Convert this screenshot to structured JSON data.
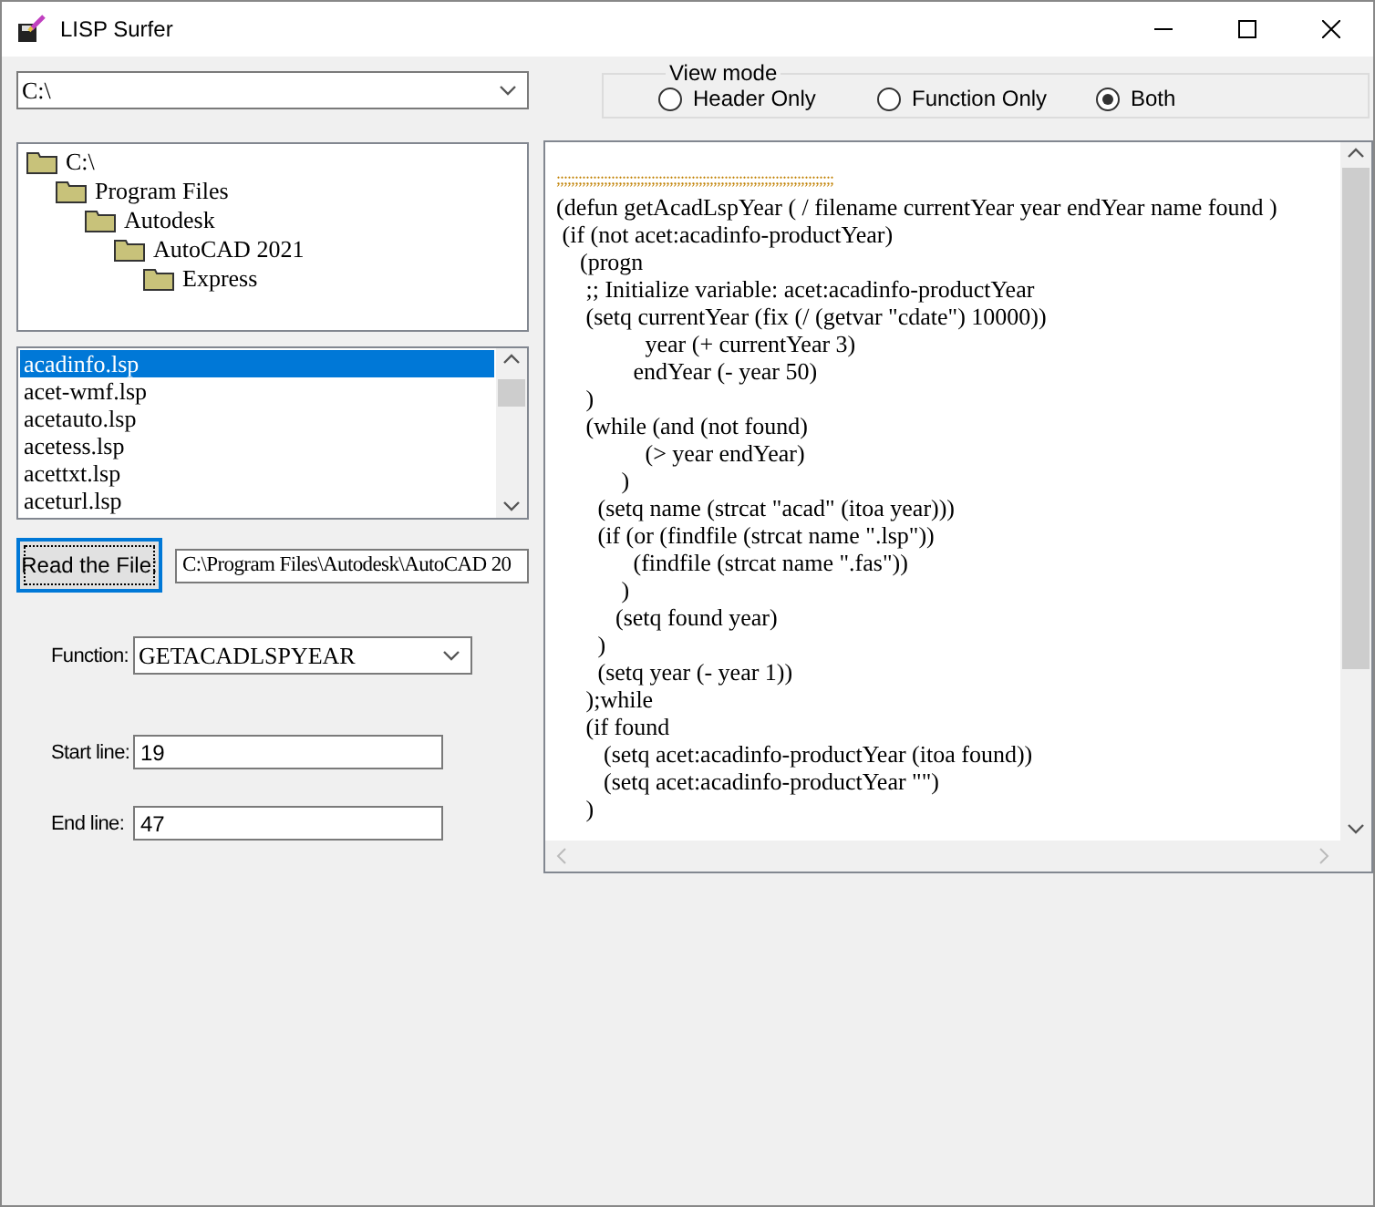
{
  "window": {
    "title": "LISP Surfer"
  },
  "drive": {
    "value": "C:\\"
  },
  "view_mode": {
    "title": "View mode",
    "options": [
      {
        "label": "Header Only",
        "selected": false
      },
      {
        "label": "Function Only",
        "selected": false
      },
      {
        "label": "Both",
        "selected": true
      }
    ]
  },
  "folders": [
    {
      "label": "C:\\",
      "children": [
        {
          "label": "Program Files",
          "children": [
            {
              "label": "Autodesk",
              "children": [
                {
                  "label": "AutoCAD 2021",
                  "children": [
                    {
                      "label": "Express"
                    }
                  ]
                }
              ]
            }
          ]
        }
      ]
    }
  ],
  "files": [
    {
      "label": "acadinfo.lsp",
      "selected": true
    },
    {
      "label": "acet-wmf.lsp",
      "selected": false
    },
    {
      "label": "acetauto.lsp",
      "selected": false
    },
    {
      "label": "acetess.lsp",
      "selected": false
    },
    {
      "label": "acettxt.lsp",
      "selected": false
    },
    {
      "label": "aceturl.lsp",
      "selected": false
    }
  ],
  "read_button": "Read the File:",
  "file_path": "C:\\Program Files\\Autodesk\\AutoCAD 20",
  "function": {
    "label": "Function:",
    "value": "GETACADLSPYEAR"
  },
  "start_line": {
    "label": "Start line:",
    "value": "19"
  },
  "end_line": {
    "label": "End line:",
    "value": "47"
  },
  "code_lines": [
    {
      "text": ";;;;;;;;;;;;;;;;;;;;;;;;;;;;;;;;;;;;;;;;;;;;;;;;;;;;;;;;;;;;;;;;;;;;;;;;;;;;",
      "kind": "rule"
    },
    {
      "text": "(defun getAcadLspYear ( / filename currentYear year endYear name found )",
      "kind": "code"
    },
    {
      "text": " (if (not acet:acadinfo-productYear)",
      "kind": "code"
    },
    {
      "text": "    (progn",
      "kind": "code"
    },
    {
      "text": "     ;; Initialize variable: acet:acadinfo-productYear",
      "kind": "code"
    },
    {
      "text": "     (setq currentYear (fix (/ (getvar \"cdate\") 10000))",
      "kind": "code"
    },
    {
      "text": "               year (+ currentYear 3)",
      "kind": "code"
    },
    {
      "text": "             endYear (- year 50)",
      "kind": "code"
    },
    {
      "text": "     )",
      "kind": "code"
    },
    {
      "text": "     (while (and (not found)",
      "kind": "code"
    },
    {
      "text": "               (> year endYear)",
      "kind": "code"
    },
    {
      "text": "           )",
      "kind": "code"
    },
    {
      "text": "       (setq name (strcat \"acad\" (itoa year)))",
      "kind": "code"
    },
    {
      "text": "       (if (or (findfile (strcat name \".lsp\"))",
      "kind": "code"
    },
    {
      "text": "             (findfile (strcat name \".fas\"))",
      "kind": "code"
    },
    {
      "text": "           )",
      "kind": "code"
    },
    {
      "text": "          (setq found year)",
      "kind": "code"
    },
    {
      "text": "       )",
      "kind": "code"
    },
    {
      "text": "       (setq year (- year 1))",
      "kind": "code"
    },
    {
      "text": "     );while",
      "kind": "code"
    },
    {
      "text": "     (if found",
      "kind": "code"
    },
    {
      "text": "        (setq acet:acadinfo-productYear (itoa found))",
      "kind": "code"
    },
    {
      "text": "        (setq acet:acadinfo-productYear \"\")",
      "kind": "code"
    },
    {
      "text": "     )",
      "kind": "code"
    }
  ]
}
